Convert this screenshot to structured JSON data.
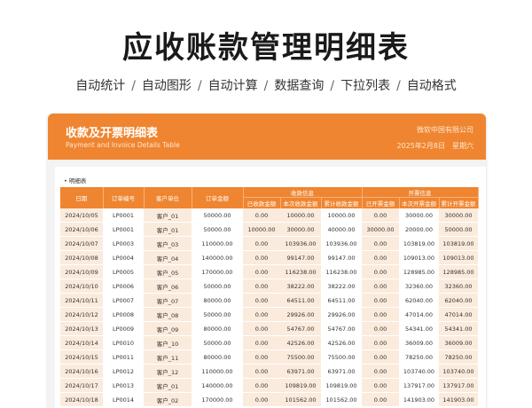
{
  "hero": {
    "title": "应收账款管理明细表",
    "features": [
      "自动统计",
      "自动图形",
      "自动计算",
      "数据查询",
      "下拉列表",
      "自动格式"
    ],
    "separator": "/"
  },
  "card": {
    "title": "收款及开票明细表",
    "subtitle": "Payment and Invoice Details Table",
    "company": "微软中国有限公司",
    "date": "2025年2月8日",
    "weekday": "星期六"
  },
  "sheet": {
    "label": "• 明细表",
    "columns": [
      "日期",
      "订单编号",
      "客户单位",
      "订单金额",
      "已收款金额",
      "本次收款金额",
      "累计收款金额",
      "已开票金额",
      "本次开票金额",
      "累计开票金额"
    ],
    "group_receipt": "收款信息",
    "group_invoice": "开票信息",
    "rows": [
      [
        "2024/10/05",
        "LP0001",
        "客户_01",
        "50000.00",
        "0.00",
        "10000.00",
        "10000.00",
        "0.00",
        "30000.00",
        "30000.00"
      ],
      [
        "2024/10/06",
        "LP0001",
        "客户_01",
        "50000.00",
        "10000.00",
        "30000.00",
        "40000.00",
        "30000.00",
        "20000.00",
        "50000.00"
      ],
      [
        "2024/10/07",
        "LP0003",
        "客户_03",
        "110000.00",
        "0.00",
        "103936.00",
        "103936.00",
        "0.00",
        "103819.00",
        "103819.00"
      ],
      [
        "2024/10/08",
        "LP0004",
        "客户_04",
        "140000.00",
        "0.00",
        "99147.00",
        "99147.00",
        "0.00",
        "109013.00",
        "109013.00"
      ],
      [
        "2024/10/09",
        "LP0005",
        "客户_05",
        "170000.00",
        "0.00",
        "116238.00",
        "116238.00",
        "0.00",
        "128985.00",
        "128985.00"
      ],
      [
        "2024/10/10",
        "LP0006",
        "客户_06",
        "50000.00",
        "0.00",
        "38222.00",
        "38222.00",
        "0.00",
        "32360.00",
        "32360.00"
      ],
      [
        "2024/10/11",
        "LP0007",
        "客户_07",
        "80000.00",
        "0.00",
        "64511.00",
        "64511.00",
        "0.00",
        "62040.00",
        "62040.00"
      ],
      [
        "2024/10/12",
        "LP0008",
        "客户_08",
        "50000.00",
        "0.00",
        "29926.00",
        "29926.00",
        "0.00",
        "47014.00",
        "47014.00"
      ],
      [
        "2024/10/13",
        "LP0009",
        "客户_09",
        "80000.00",
        "0.00",
        "54767.00",
        "54767.00",
        "0.00",
        "54341.00",
        "54341.00"
      ],
      [
        "2024/10/14",
        "LP0010",
        "客户_10",
        "50000.00",
        "0.00",
        "42526.00",
        "42526.00",
        "0.00",
        "36009.00",
        "36009.00"
      ],
      [
        "2024/10/15",
        "LP0011",
        "客户_11",
        "80000.00",
        "0.00",
        "75500.00",
        "75500.00",
        "0.00",
        "78250.00",
        "78250.00"
      ],
      [
        "2024/10/16",
        "LP0012",
        "客户_12",
        "110000.00",
        "0.00",
        "63971.00",
        "63971.00",
        "0.00",
        "103740.00",
        "103740.00"
      ],
      [
        "2024/10/17",
        "LP0013",
        "客户_01",
        "140000.00",
        "0.00",
        "109819.00",
        "109819.00",
        "0.00",
        "137917.00",
        "137917.00"
      ],
      [
        "2024/10/18",
        "LP0014",
        "客户_02",
        "170000.00",
        "0.00",
        "101562.00",
        "101562.00",
        "0.00",
        "141903.00",
        "141903.00"
      ]
    ]
  }
}
